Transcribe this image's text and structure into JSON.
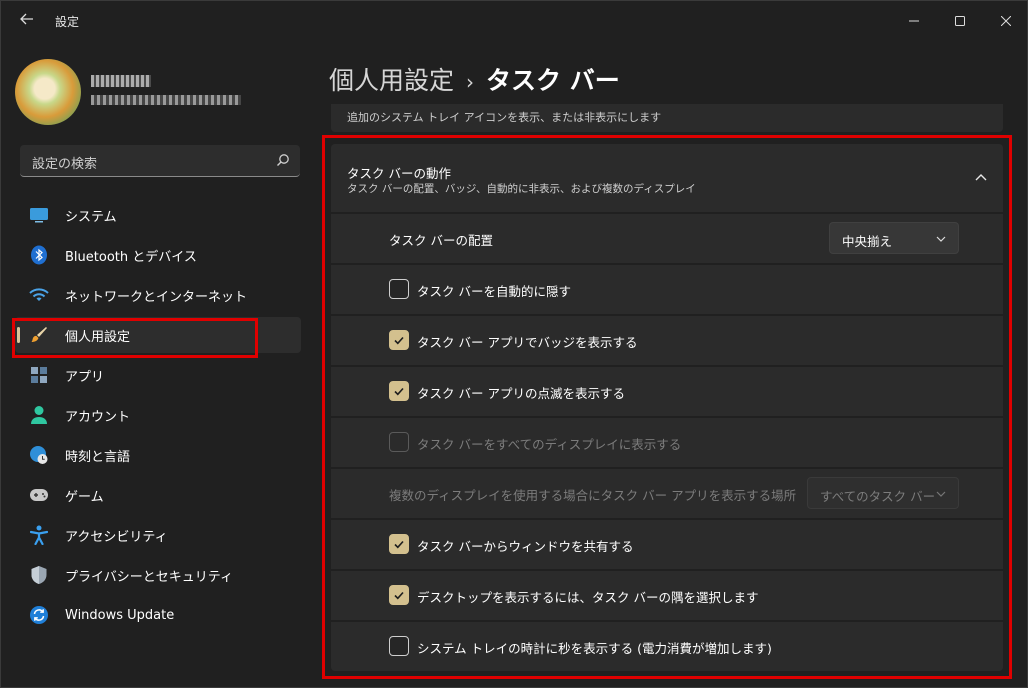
{
  "window": {
    "title": "設定"
  },
  "sidebar": {
    "search_placeholder": "設定の検索",
    "items": [
      {
        "label": "システム",
        "icon": "monitor-icon"
      },
      {
        "label": "Bluetooth とデバイス",
        "icon": "bluetooth-icon"
      },
      {
        "label": "ネットワークとインターネット",
        "icon": "wifi-icon"
      },
      {
        "label": "個人用設定",
        "icon": "brush-icon",
        "active": true
      },
      {
        "label": "アプリ",
        "icon": "apps-icon"
      },
      {
        "label": "アカウント",
        "icon": "person-icon"
      },
      {
        "label": "時刻と言語",
        "icon": "globe-clock-icon"
      },
      {
        "label": "ゲーム",
        "icon": "gamepad-icon"
      },
      {
        "label": "アクセシビリティ",
        "icon": "accessibility-icon"
      },
      {
        "label": "プライバシーとセキュリティ",
        "icon": "shield-icon"
      },
      {
        "label": "Windows Update",
        "icon": "update-icon"
      }
    ]
  },
  "main": {
    "breadcrumb_parent": "個人用設定",
    "breadcrumb_separator": "›",
    "page_title": "タスク バー",
    "prev_card_text": "追加のシステム トレイ アイコンを表示、または非表示にします",
    "group": {
      "title": "タスク バーの動作",
      "subtitle": "タスク バーの配置、バッジ、自動的に非表示、および複数のディスプレイ",
      "alignment_label": "タスク バーの配置",
      "alignment_value": "中央揃え",
      "options": [
        {
          "label": "タスク バーを自動的に隠す",
          "checked": false,
          "disabled": false
        },
        {
          "label": "タスク バー アプリでバッジを表示する",
          "checked": true,
          "disabled": false
        },
        {
          "label": "タスク バー アプリの点滅を表示する",
          "checked": true,
          "disabled": false
        },
        {
          "label": "タスク バーをすべてのディスプレイに表示する",
          "checked": false,
          "disabled": true
        }
      ],
      "multi_display_label": "複数のディスプレイを使用する場合にタスク バー アプリを表示する場所",
      "multi_display_value": "すべてのタスク バー",
      "options2": [
        {
          "label": "タスク バーからウィンドウを共有する",
          "checked": true,
          "disabled": false
        },
        {
          "label": "デスクトップを表示するには、タスク バーの隅を選択します",
          "checked": true,
          "disabled": false
        },
        {
          "label": "システム トレイの時計に秒を表示する (電力消費が増加します)",
          "checked": false,
          "disabled": false
        }
      ]
    }
  },
  "colors": {
    "accent": "#d3c08e",
    "highlight": "#e00000",
    "background": "#202020",
    "card": "#2b2b2b"
  }
}
